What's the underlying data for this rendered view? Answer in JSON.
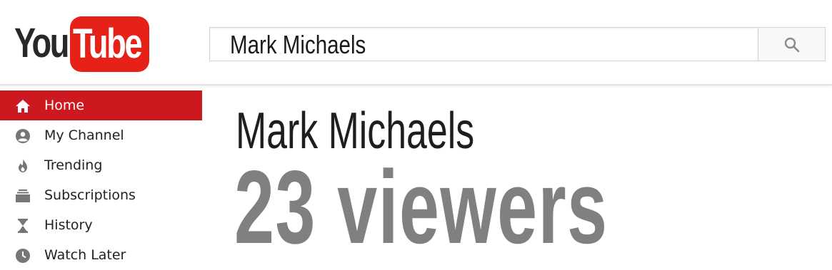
{
  "logo": {
    "part1": "You",
    "part2": "Tube"
  },
  "search": {
    "value": "Mark Michaels"
  },
  "sidebar": {
    "items": [
      {
        "label": "Home",
        "icon": "home-icon",
        "active": true
      },
      {
        "label": "My Channel",
        "icon": "account-icon",
        "active": false
      },
      {
        "label": "Trending",
        "icon": "flame-icon",
        "active": false
      },
      {
        "label": "Subscriptions",
        "icon": "subscriptions-icon",
        "active": false
      },
      {
        "label": "History",
        "icon": "hourglass-icon",
        "active": false
      },
      {
        "label": "Watch Later",
        "icon": "clock-icon",
        "active": false
      }
    ]
  },
  "main": {
    "title": "Mark Michaels",
    "viewers": "23 viewers"
  },
  "colors": {
    "brand_red": "#e62117",
    "active_red": "#cc181e",
    "viewers_gray": "#808080"
  }
}
